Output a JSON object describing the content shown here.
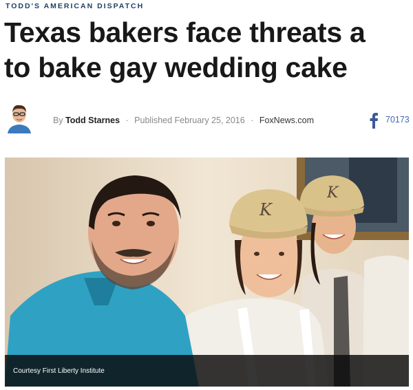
{
  "article": {
    "kicker": "TODD'S AMERICAN DISPATCH",
    "headline_line1": "Texas bakers face threats a",
    "headline_line2": "to bake gay wedding cake"
  },
  "byline": {
    "prefix": "By",
    "author": "Todd Starnes",
    "sep": "·",
    "published": "Published February 25, 2016",
    "source": "FoxNews.com"
  },
  "share": {
    "icon": "facebook-icon",
    "count": "70173"
  },
  "photo": {
    "caption": "Courtesy First Liberty Institute",
    "cap_monogram": "K"
  },
  "colors": {
    "kicker": "#1f3f63",
    "facebook": "#3b5998",
    "caption_bar": "#0a0a0a"
  }
}
